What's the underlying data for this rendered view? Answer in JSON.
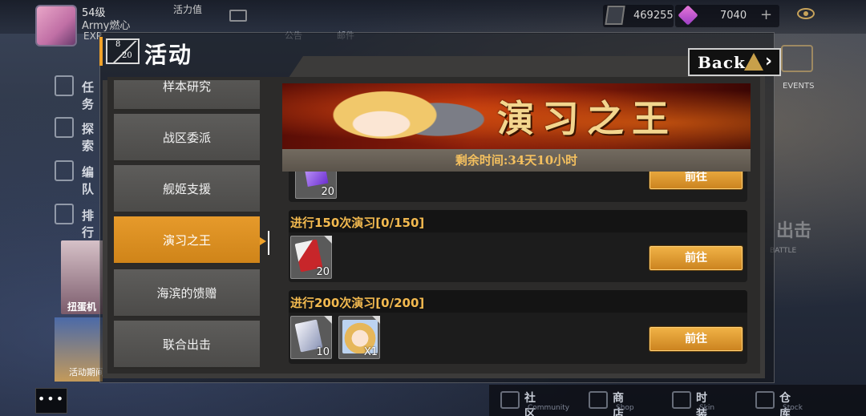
{
  "player": {
    "level": "54级",
    "name": "Army燃心",
    "exp_label": "EXP",
    "stamina_label": "活力值"
  },
  "resources": {
    "resource1": "469255",
    "resource2": "7040"
  },
  "top_tabs": [
    "公告",
    "邮件"
  ],
  "bg_menu": [
    {
      "label": "任务",
      "icon": "task-icon"
    },
    {
      "label": "探索",
      "icon": "explore-icon"
    },
    {
      "label": "编队",
      "icon": "formation-icon"
    },
    {
      "label": "排行",
      "icon": "rank-icon"
    }
  ],
  "gacha_label": "扭蛋机",
  "left_banner_label": "活动期间",
  "more_label": "•••",
  "events_label": "EVENTS",
  "battle_label": "出击",
  "battle_sub": "BATTLE",
  "bottom_nav": [
    {
      "label": "社区",
      "sub": "Community",
      "icon": "community-icon"
    },
    {
      "label": "商店",
      "sub": "Shop",
      "icon": "shop-icon"
    },
    {
      "label": "时装",
      "sub": "Skin",
      "icon": "skin-icon"
    },
    {
      "label": "仓库",
      "sub": "Stock",
      "icon": "stock-icon"
    }
  ],
  "modal": {
    "page_current": "8",
    "page_total": "20",
    "title": "活动",
    "back_label": "Back"
  },
  "sidebar": [
    {
      "label": "样本研究",
      "active": false
    },
    {
      "label": "战区委派",
      "active": false
    },
    {
      "label": "舰姬支援",
      "active": false
    },
    {
      "label": "演习之王",
      "active": true
    },
    {
      "label": "海滨的馈赠",
      "active": false
    },
    {
      "label": "联合出击",
      "active": false
    }
  ],
  "banner": {
    "title": "演习之王",
    "time_left": "剩余时间:34天10小时"
  },
  "tasks": [
    {
      "title": "",
      "rewards": [
        {
          "icon": "purple-crystal-icon",
          "qty": "20"
        }
      ],
      "button": "前往"
    },
    {
      "title": "进行150次演习[0/150]",
      "rewards": [
        {
          "icon": "red-ticket-icon",
          "qty": "20"
        }
      ],
      "button": "前往"
    },
    {
      "title": "进行200次演习[0/200]",
      "rewards": [
        {
          "icon": "silver-ticket-icon",
          "qty": "10"
        },
        {
          "icon": "character-portrait-icon",
          "qty": "X1"
        }
      ],
      "button": "前往"
    }
  ],
  "colors": {
    "accent": "#f0a22a",
    "task_title": "#f2b94f",
    "time": "#f4c05f"
  }
}
